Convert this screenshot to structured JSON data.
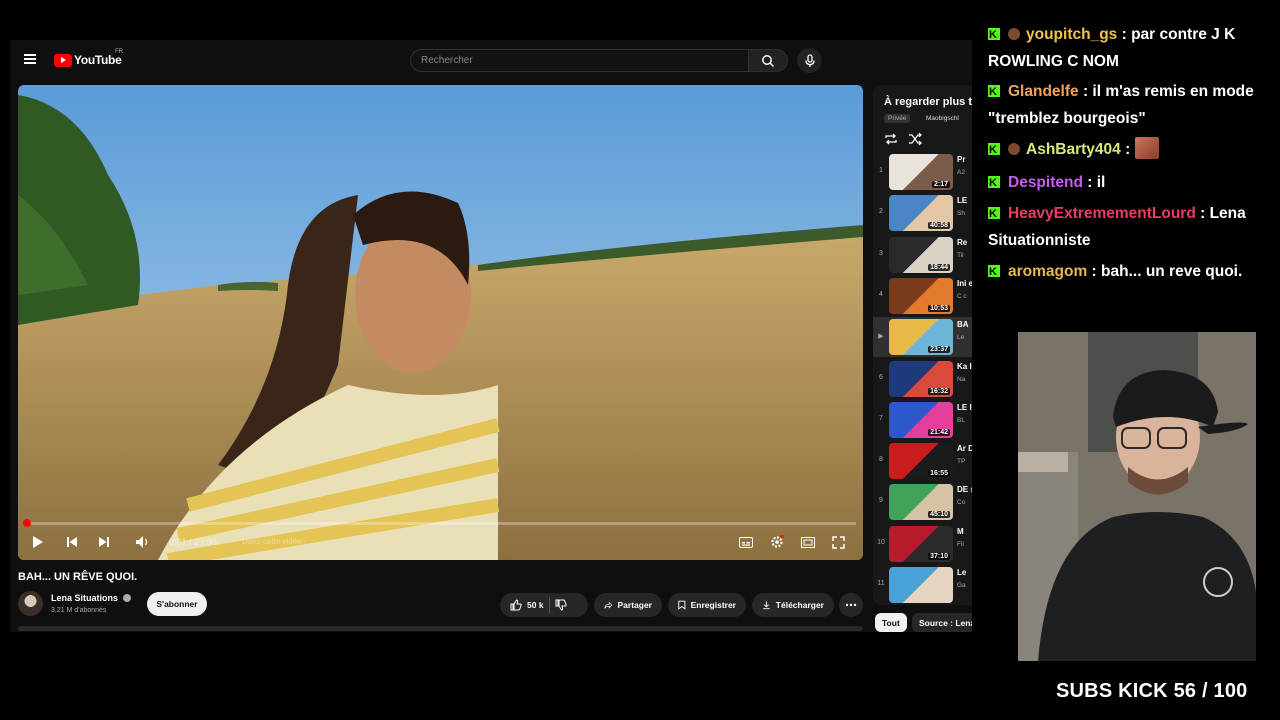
{
  "youtube": {
    "logo_text": "YouTube",
    "region": "FR",
    "search_placeholder": "Rechercher"
  },
  "player": {
    "current_time": "0:01",
    "duration": "23:36",
    "time_separator": "/",
    "chapter_hint": "Dans cette vidéo",
    "progress_fraction": 0.001
  },
  "video": {
    "title": "BAH... UN RÊVE QUOI.",
    "channel": "Lena Situations",
    "subscribers": "3,21 M d'abonnés",
    "subscribe_label": "S'abonner",
    "likes": "50 k",
    "share_label": "Partager",
    "save_label": "Enregistrer",
    "download_label": "Télécharger"
  },
  "playlist": {
    "title": "À regarder plus tard",
    "privacy": "Privée",
    "owner": "Maobigschl",
    "items": [
      {
        "num": "1",
        "duration": "2:17",
        "title": "Pr",
        "sub": "A2",
        "active": false,
        "colors": [
          "#e9e4dc",
          "#7b5c4b"
        ]
      },
      {
        "num": "2",
        "duration": "40:58",
        "title": "LE",
        "sub": "Sh",
        "active": false,
        "colors": [
          "#4a86c5",
          "#e3c7a7"
        ]
      },
      {
        "num": "3",
        "duration": "18:44",
        "title": "Re",
        "sub": "Til",
        "active": false,
        "colors": [
          "#2a2a2a",
          "#d9d2c5"
        ]
      },
      {
        "num": "4",
        "duration": "10:53",
        "title": "Ini et",
        "sub": "C c",
        "active": false,
        "colors": [
          "#7a3b1d",
          "#e27b2d"
        ]
      },
      {
        "num": "",
        "duration": "23:37",
        "title": "BA",
        "sub": "Le",
        "active": true,
        "colors": [
          "#e9b94a",
          "#6db6d8"
        ]
      },
      {
        "num": "6",
        "duration": "16:32",
        "title": "Ka les",
        "sub": "Na",
        "active": false,
        "colors": [
          "#1e3a7a",
          "#d94a3a"
        ]
      },
      {
        "num": "7",
        "duration": "21:42",
        "title": "LE IN",
        "sub": "BL",
        "active": false,
        "colors": [
          "#2d58c9",
          "#e43f9b"
        ]
      },
      {
        "num": "8",
        "duration": "16:55",
        "title": "Ar DE",
        "sub": "TP",
        "active": false,
        "colors": [
          "#c91c1c",
          "#1b1b1b"
        ]
      },
      {
        "num": "9",
        "duration": "45:10",
        "title": "DE @",
        "sub": "Co",
        "active": false,
        "colors": [
          "#3fa45a",
          "#d8c2a5"
        ]
      },
      {
        "num": "10",
        "duration": "37:10",
        "title": "M",
        "sub": "Fil",
        "active": false,
        "colors": [
          "#b71c2a",
          "#2b2b2b"
        ]
      },
      {
        "num": "11",
        "duration": "",
        "title": "Le",
        "sub": "Ga",
        "active": false,
        "colors": [
          "#4aa3d8",
          "#e6d6c1"
        ]
      }
    ],
    "chips": [
      "Tout",
      "Source : Lena"
    ]
  },
  "chat": {
    "messages": [
      {
        "user": "youpitch_gs",
        "color": "#f2c14e",
        "sub": true,
        "text": "par contre J K ROWLING C NOM"
      },
      {
        "user": "Glandelfe",
        "color": "#f0a35e",
        "sub": false,
        "text": "il m'as remis en mode \"tremblez bourgeois\""
      },
      {
        "user": "AshBarty404",
        "color": "#d6e97a",
        "sub": true,
        "text": "",
        "emote": true
      },
      {
        "user": "Despitend",
        "color": "#c45ef2",
        "sub": false,
        "text": "il"
      },
      {
        "user": "HeavyExtremementLourd",
        "color": "#f03a63",
        "sub": false,
        "text": "Lena Situationniste"
      },
      {
        "user": "aromagom",
        "color": "#e6b84f",
        "sub": false,
        "text": "bah... un reve quoi."
      }
    ]
  },
  "stream": {
    "subs_goal_label": "SUBS KICK",
    "subs_current": "56",
    "subs_target": "100"
  }
}
